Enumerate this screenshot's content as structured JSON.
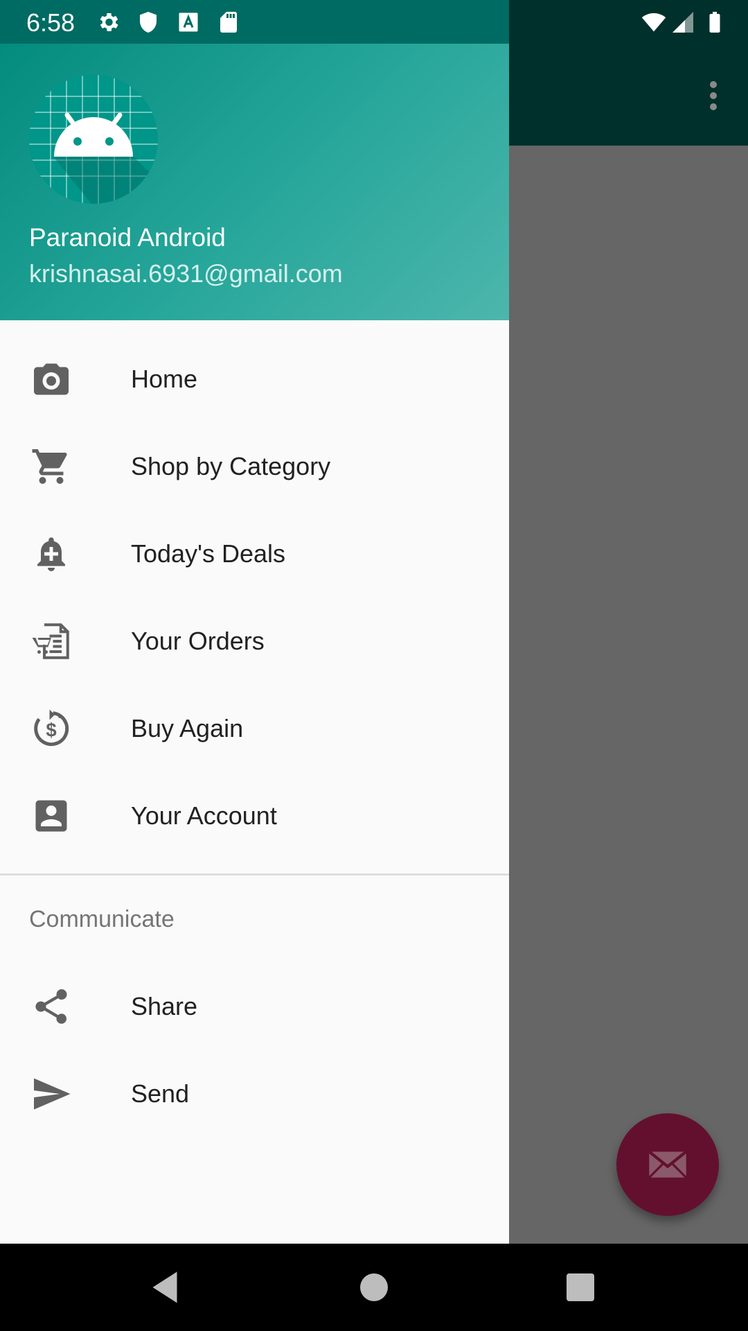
{
  "status_bar": {
    "time": "6:58",
    "left_icons": [
      "settings-icon",
      "shield-icon",
      "font-a-icon",
      "sd-card-icon"
    ],
    "right_icons": [
      "wifi-icon",
      "signal-icon",
      "battery-icon"
    ]
  },
  "app_bar": {
    "overflow_icon": "more-vert-icon"
  },
  "drawer": {
    "header": {
      "user_name": "Paranoid Android",
      "user_email": "krishnasai.6931@gmail.com"
    },
    "items": [
      {
        "label": "Home",
        "icon": "camera-icon"
      },
      {
        "label": "Shop by Category",
        "icon": "cart-icon"
      },
      {
        "label": "Today's Deals",
        "icon": "bell-plus-icon"
      },
      {
        "label": "Your Orders",
        "icon": "orders-icon"
      },
      {
        "label": "Buy Again",
        "icon": "dollar-refresh-icon"
      },
      {
        "label": "Your Account",
        "icon": "account-box-icon"
      }
    ],
    "section": {
      "header": "Communicate",
      "items": [
        {
          "label": "Share",
          "icon": "share-icon"
        },
        {
          "label": "Send",
          "icon": "send-icon"
        }
      ]
    }
  },
  "fab": {
    "icon": "mail-icon",
    "color": "#63102e"
  },
  "colors": {
    "header_start": "#00897b",
    "header_end": "#4db6ac",
    "app_bar": "#00302b",
    "scrim": "#666666"
  },
  "nav_bar": {
    "icons": [
      "back-icon",
      "home-icon",
      "recents-icon"
    ]
  }
}
